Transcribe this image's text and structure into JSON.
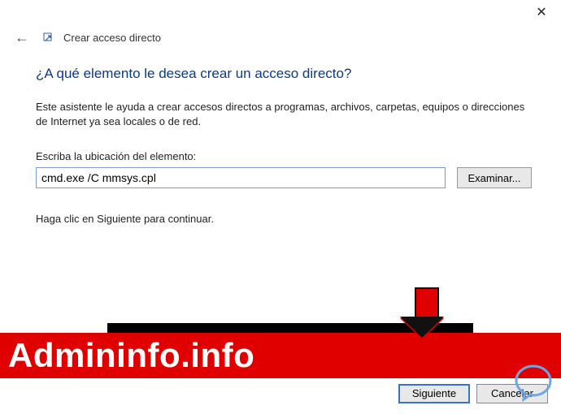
{
  "titlebar": {
    "close_glyph": "✕"
  },
  "header": {
    "back_glyph": "←",
    "wizard_title": "Crear acceso directo"
  },
  "content": {
    "heading": "¿A qué elemento le desea crear un acceso directo?",
    "description": "Este asistente le ayuda a crear accesos directos a programas, archivos, carpetas, equipos o direcciones de Internet ya sea locales o de red.",
    "field_label": "Escriba la ubicación del elemento:",
    "path_value": "cmd.exe /C mmsys.cpl",
    "browse_label": "Examinar...",
    "hint": "Haga clic en Siguiente para continuar."
  },
  "footer": {
    "next_label": "Siguiente",
    "next_visible_fragment": "ente",
    "cancel_label": "Cancelar"
  },
  "watermark": {
    "text": "Admininfo.info"
  }
}
